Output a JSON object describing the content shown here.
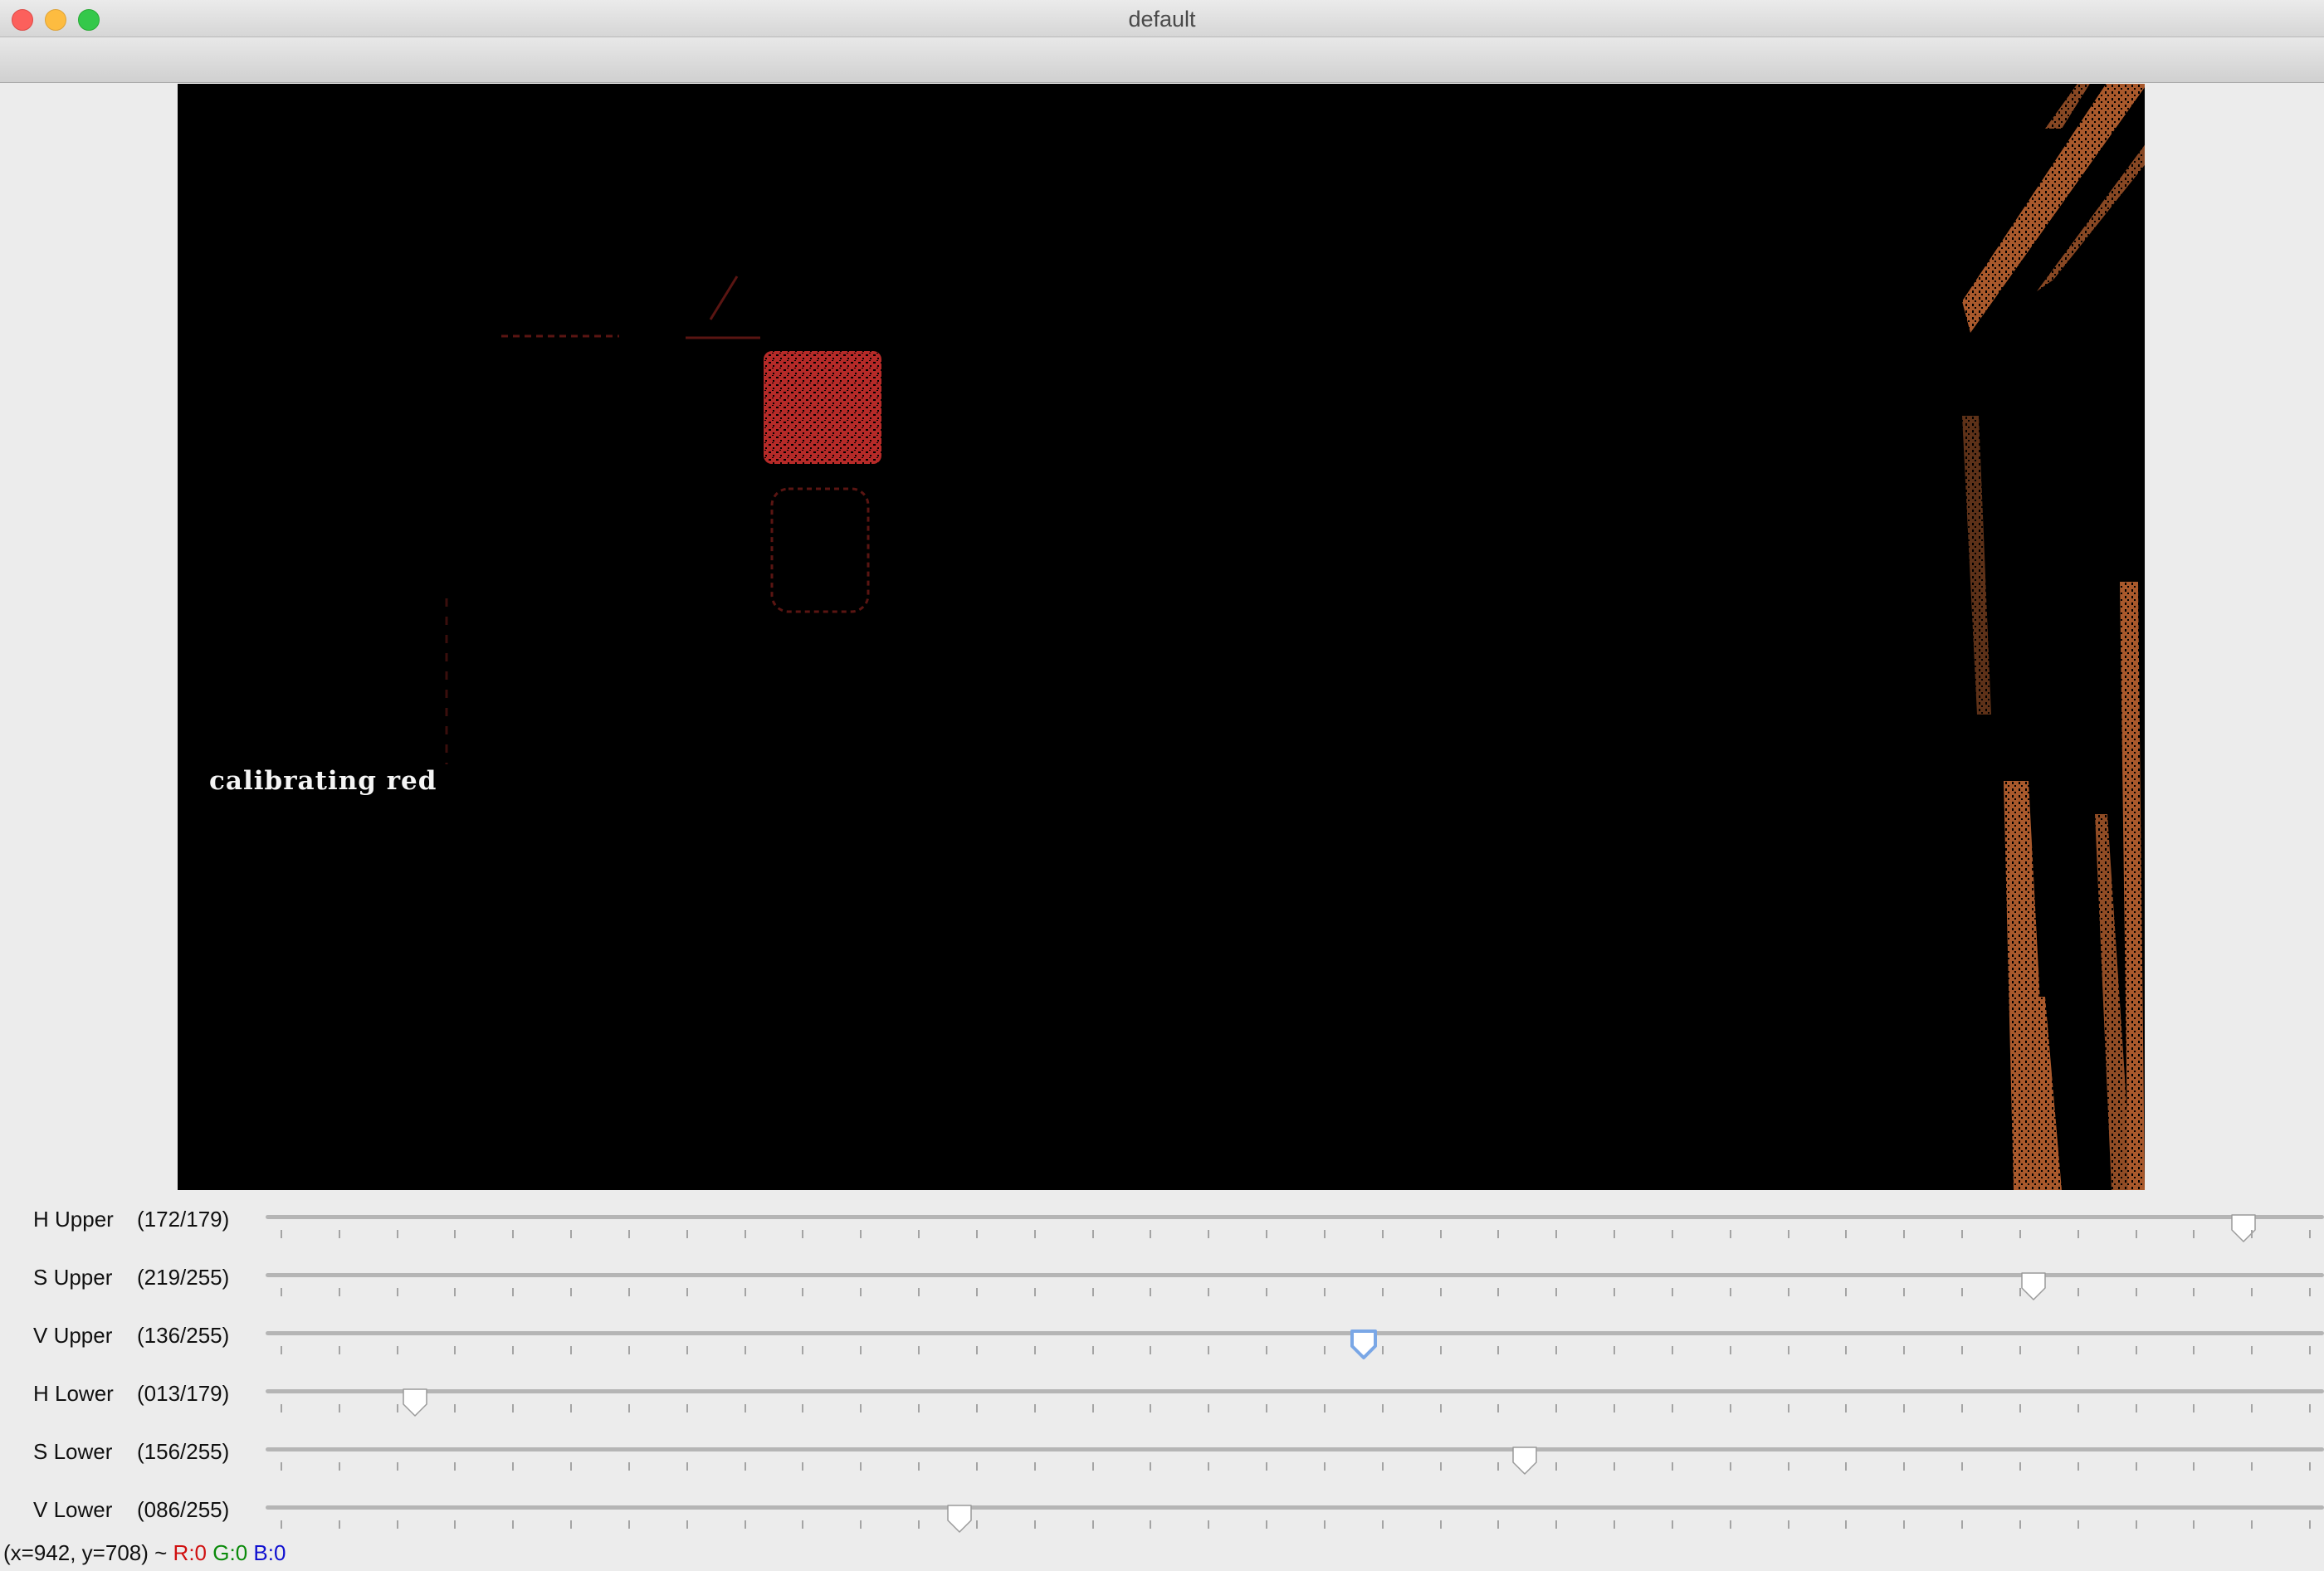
{
  "window": {
    "title": "default"
  },
  "overlay": {
    "text": "calibrating red"
  },
  "trackbars": [
    {
      "name": "H Upper",
      "value_text": "(172/179)",
      "value": 172,
      "max": 179,
      "focused": false
    },
    {
      "name": "S Upper",
      "value_text": "(219/255)",
      "value": 219,
      "max": 255,
      "focused": false
    },
    {
      "name": "V Upper",
      "value_text": "(136/255)",
      "value": 136,
      "max": 255,
      "focused": true
    },
    {
      "name": "H Lower",
      "value_text": "(013/179)",
      "value": 13,
      "max": 179,
      "focused": false
    },
    {
      "name": "S Lower",
      "value_text": "(156/255)",
      "value": 156,
      "max": 255,
      "focused": false
    },
    {
      "name": "V Lower",
      "value_text": "(086/255)",
      "value": 86,
      "max": 255,
      "focused": false
    }
  ],
  "status": {
    "coords": "(x=942, y=708) ~",
    "r": "R:0",
    "g": "G:0",
    "b": "B:0"
  },
  "colors": {
    "red_mask": "#b52a28",
    "orange_mask": "#a9592c",
    "focus_ring": "#7aa7e6"
  }
}
